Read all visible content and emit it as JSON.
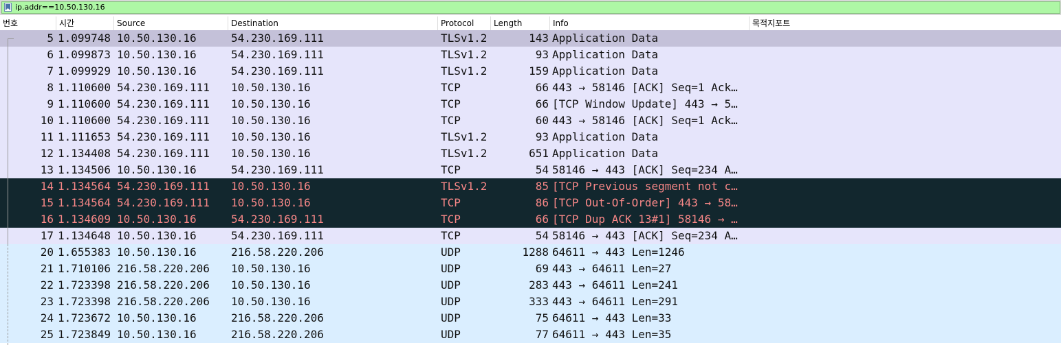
{
  "filter": {
    "value": "ip.addr==10.50.130.16"
  },
  "icons": {
    "bookmark": "bookmark-icon"
  },
  "columns": {
    "no": "번호",
    "time": "시간",
    "source": "Source",
    "destination": "Destination",
    "protocol": "Protocol",
    "length": "Length",
    "info": "Info",
    "dest_port": "목적지포트"
  },
  "colors": {
    "selected_bg": "#c4c1d9",
    "tcp_bg": "#e6e5fb",
    "udp_bg": "#daeeff",
    "bad_bg": "#12272e",
    "bad_fg": "#f78787"
  },
  "packets": [
    {
      "no": "5",
      "time": "1.099748",
      "src": "10.50.130.16",
      "dst": "54.230.169.111",
      "proto": "TLSv1.2",
      "len": "143",
      "info": "Application Data",
      "kind": "selected"
    },
    {
      "no": "6",
      "time": "1.099873",
      "src": "10.50.130.16",
      "dst": "54.230.169.111",
      "proto": "TLSv1.2",
      "len": "93",
      "info": "Application Data",
      "kind": "tcp"
    },
    {
      "no": "7",
      "time": "1.099929",
      "src": "10.50.130.16",
      "dst": "54.230.169.111",
      "proto": "TLSv1.2",
      "len": "159",
      "info": "Application Data",
      "kind": "tcp"
    },
    {
      "no": "8",
      "time": "1.110600",
      "src": "54.230.169.111",
      "dst": "10.50.130.16",
      "proto": "TCP",
      "len": "66",
      "info": "443 → 58146 [ACK] Seq=1 Ack…",
      "kind": "tcp"
    },
    {
      "no": "9",
      "time": "1.110600",
      "src": "54.230.169.111",
      "dst": "10.50.130.16",
      "proto": "TCP",
      "len": "66",
      "info": "[TCP Window Update] 443 → 5…",
      "kind": "tcp"
    },
    {
      "no": "10",
      "time": "1.110600",
      "src": "54.230.169.111",
      "dst": "10.50.130.16",
      "proto": "TCP",
      "len": "60",
      "info": "443 → 58146 [ACK] Seq=1 Ack…",
      "kind": "tcp"
    },
    {
      "no": "11",
      "time": "1.111653",
      "src": "54.230.169.111",
      "dst": "10.50.130.16",
      "proto": "TLSv1.2",
      "len": "93",
      "info": "Application Data",
      "kind": "tcp"
    },
    {
      "no": "12",
      "time": "1.134408",
      "src": "54.230.169.111",
      "dst": "10.50.130.16",
      "proto": "TLSv1.2",
      "len": "651",
      "info": "Application Data",
      "kind": "tcp"
    },
    {
      "no": "13",
      "time": "1.134506",
      "src": "10.50.130.16",
      "dst": "54.230.169.111",
      "proto": "TCP",
      "len": "54",
      "info": "58146 → 443 [ACK] Seq=234 A…",
      "kind": "tcp"
    },
    {
      "no": "14",
      "time": "1.134564",
      "src": "54.230.169.111",
      "dst": "10.50.130.16",
      "proto": "TLSv1.2",
      "len": "85",
      "info": "[TCP Previous segment not c…",
      "kind": "bad"
    },
    {
      "no": "15",
      "time": "1.134564",
      "src": "54.230.169.111",
      "dst": "10.50.130.16",
      "proto": "TCP",
      "len": "86",
      "info": "[TCP Out-Of-Order] 443 → 58…",
      "kind": "bad"
    },
    {
      "no": "16",
      "time": "1.134609",
      "src": "10.50.130.16",
      "dst": "54.230.169.111",
      "proto": "TCP",
      "len": "66",
      "info": "[TCP Dup ACK 13#1] 58146 → …",
      "kind": "bad"
    },
    {
      "no": "17",
      "time": "1.134648",
      "src": "10.50.130.16",
      "dst": "54.230.169.111",
      "proto": "TCP",
      "len": "54",
      "info": "58146 → 443 [ACK] Seq=234 A…",
      "kind": "tcp"
    },
    {
      "no": "20",
      "time": "1.655383",
      "src": "10.50.130.16",
      "dst": "216.58.220.206",
      "proto": "UDP",
      "len": "1288",
      "info": "64611 → 443 Len=1246",
      "kind": "udp"
    },
    {
      "no": "21",
      "time": "1.710106",
      "src": "216.58.220.206",
      "dst": "10.50.130.16",
      "proto": "UDP",
      "len": "69",
      "info": "443 → 64611 Len=27",
      "kind": "udp"
    },
    {
      "no": "22",
      "time": "1.723398",
      "src": "216.58.220.206",
      "dst": "10.50.130.16",
      "proto": "UDP",
      "len": "283",
      "info": "443 → 64611 Len=241",
      "kind": "udp"
    },
    {
      "no": "23",
      "time": "1.723398",
      "src": "216.58.220.206",
      "dst": "10.50.130.16",
      "proto": "UDP",
      "len": "333",
      "info": "443 → 64611 Len=291",
      "kind": "udp"
    },
    {
      "no": "24",
      "time": "1.723672",
      "src": "10.50.130.16",
      "dst": "216.58.220.206",
      "proto": "UDP",
      "len": "75",
      "info": "64611 → 443 Len=33",
      "kind": "udp"
    },
    {
      "no": "25",
      "time": "1.723849",
      "src": "10.50.130.16",
      "dst": "216.58.220.206",
      "proto": "UDP",
      "len": "77",
      "info": "64611 → 443 Len=35",
      "kind": "udp"
    }
  ]
}
